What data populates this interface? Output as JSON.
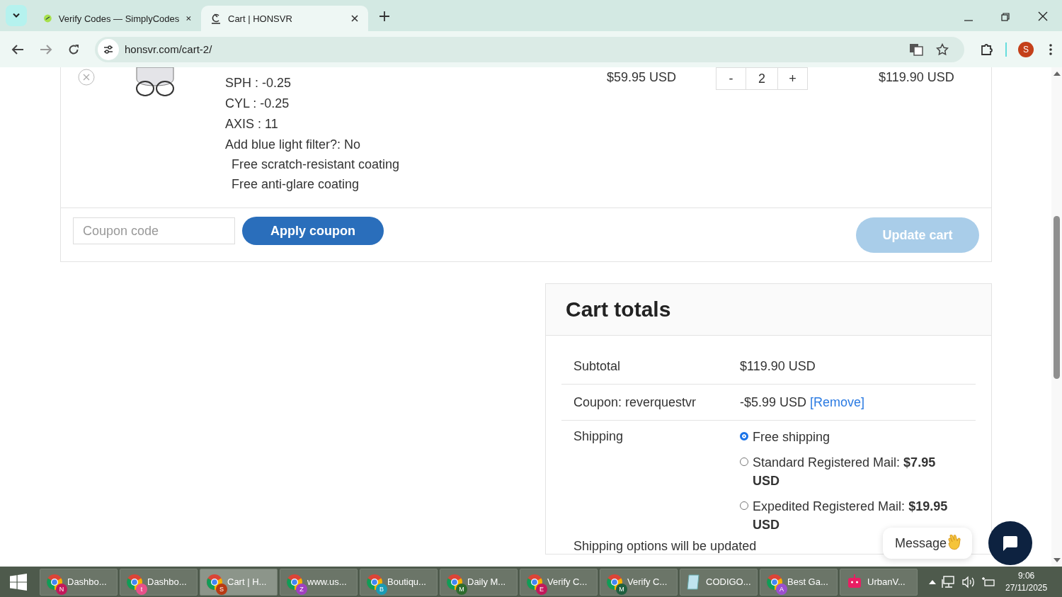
{
  "browser": {
    "tabs": [
      {
        "title": "Verify Codes — SimplyCodes",
        "kind": "simplycodes",
        "selected": false
      },
      {
        "title": "Cart | HONSVR",
        "kind": "honsvr",
        "selected": true
      }
    ],
    "address": "honsvr.com/cart-2/",
    "profile_initial": "S"
  },
  "product": {
    "details": [
      "SPH : -0.25",
      "CYL : -0.25",
      "AXIS : 11",
      "Add blue light filter?: No"
    ],
    "extras": [
      "Free scratch-resistant coating",
      "Free anti-glare coating"
    ],
    "price": "$59.95 USD",
    "quantity": "2",
    "minus": "-",
    "plus": "+",
    "subtotal": "$119.90 USD"
  },
  "coupon": {
    "placeholder": "Coupon code",
    "apply_label": "Apply coupon",
    "update_label": "Update cart",
    "update_disabled": true
  },
  "totals": {
    "title": "Cart totals",
    "subtotal_label": "Subtotal",
    "subtotal_value": "$119.90 USD",
    "coupon_label": "Coupon: reverquestvr",
    "coupon_value": "-$5.99 USD",
    "coupon_link": "[Remove]",
    "shipping_label": "Shipping",
    "shipping_options": [
      {
        "label": "Free shipping",
        "selected": true
      },
      {
        "label": "Standard Registered Mail: ",
        "price": "$7.95 USD",
        "selected": false
      },
      {
        "label": "Expedited Registered Mail: ",
        "price": "$19.95 USD",
        "selected": false
      }
    ],
    "note": "Shipping options will be updated"
  },
  "chat": {
    "label": "Message"
  },
  "taskbar": {
    "items": [
      {
        "label": "Dashbo...",
        "kind": "chrome",
        "badge": "N",
        "color": "#c2185b",
        "selected": false
      },
      {
        "label": "Dashbo...",
        "kind": "chrome",
        "badge": "t",
        "color": "#e8508a",
        "selected": false
      },
      {
        "label": "Cart | H...",
        "kind": "chrome",
        "badge": "S",
        "color": "#b83a14",
        "selected": true
      },
      {
        "label": "www.us...",
        "kind": "chrome",
        "badge": "Z",
        "color": "#a040c0",
        "selected": false
      },
      {
        "label": "Boutiqu...",
        "kind": "chrome",
        "badge": "B",
        "color": "#1a9bb5",
        "selected": false
      },
      {
        "label": "Daily M...",
        "kind": "chrome",
        "badge": "M",
        "color": "#2e6b2e",
        "selected": false
      },
      {
        "label": "Verify C...",
        "kind": "chrome",
        "badge": "E",
        "color": "#c2185b",
        "selected": false
      },
      {
        "label": "Verify C...",
        "kind": "chrome",
        "badge": "M",
        "color": "#1f5f3f",
        "selected": false
      },
      {
        "label": "CODIGO...",
        "kind": "notepad",
        "selected": false
      },
      {
        "label": "Best Ga...",
        "kind": "chrome",
        "badge": "A",
        "color": "#9b4fcf",
        "selected": false
      },
      {
        "label": "UrbanV...",
        "kind": "robot",
        "selected": false
      }
    ],
    "time": "9:06",
    "date": "27/11/2025"
  }
}
